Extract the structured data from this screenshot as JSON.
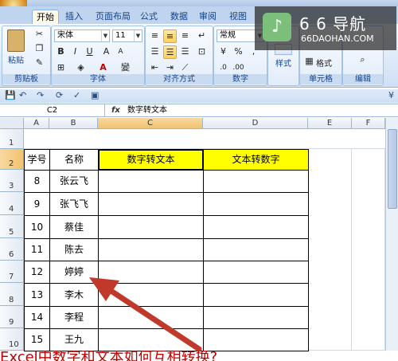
{
  "tabs": [
    "开始",
    "插入",
    "页面布局",
    "公式",
    "数据",
    "审阅",
    "视图"
  ],
  "ribbon": {
    "paste_label": "粘贴",
    "clipboard_label": "剪贴板",
    "font_name": "宋体",
    "font_size": "11",
    "font_group_label": "字体",
    "align_group_label": "对齐方式",
    "number_format": "常规",
    "number_group_label": "数字",
    "style_label": "样式",
    "format_label": "格式",
    "cells_group_label": "单元格",
    "edit_group_label": "编辑",
    "bold": "B",
    "italic": "I",
    "underline": "U",
    "font_color": "A",
    "wen": "變",
    "percent": "%",
    "comma": ","
  },
  "watermark": {
    "title": "6 6 导航",
    "url": "66DAOHAN.COM"
  },
  "formula_bar": {
    "name_box": "C2",
    "fx": "fx",
    "formula": "数字转文本"
  },
  "columns": [
    "A",
    "B",
    "C",
    "D",
    "E",
    "F"
  ],
  "rows": [
    "1",
    "2",
    "3",
    "4",
    "5",
    "6",
    "7",
    "8",
    "9",
    "10"
  ],
  "table": {
    "headers": [
      "学号",
      "名称",
      "数字转文本",
      "文本转数字"
    ],
    "data": [
      [
        "8",
        "张云飞"
      ],
      [
        "9",
        "张飞飞"
      ],
      [
        "10",
        "蔡佳"
      ],
      [
        "11",
        "陈去"
      ],
      [
        "12",
        "婷婷"
      ],
      [
        "13",
        "李木"
      ],
      [
        "14",
        "李程"
      ],
      [
        "15",
        "王九"
      ]
    ]
  },
  "caption": "Excel中数字和文本如何互相转换?",
  "colors": {
    "header_fill": "#ffff00",
    "arrow": "#c0392b",
    "caption": "#c00000"
  }
}
